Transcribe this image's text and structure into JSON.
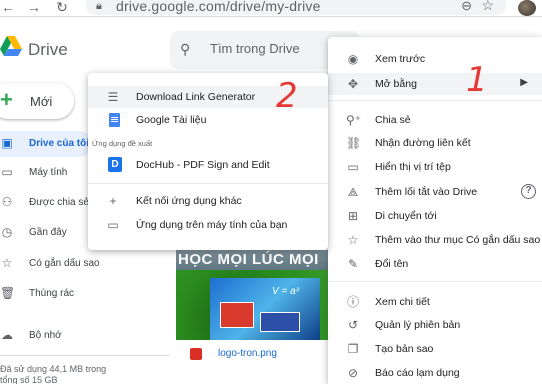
{
  "browser": {
    "url": "drive.google.com/drive/my-drive"
  },
  "header": {
    "logo_text": "Drive",
    "search_placeholder": "Tìm trong Drive"
  },
  "sidebar": {
    "new_label": "Mới",
    "items": [
      {
        "label": "Drive của tôi",
        "icon": "drive-icon",
        "active": true
      },
      {
        "label": "Máy tính",
        "icon": "computer-icon"
      },
      {
        "label": "Được chia sẻ",
        "icon": "people-icon"
      },
      {
        "label": "Gần đây",
        "icon": "clock-icon"
      },
      {
        "label": "Có gắn dấu sao",
        "icon": "star-icon"
      },
      {
        "label": "Thùng rác",
        "icon": "trash-icon"
      },
      {
        "label": "Bộ nhớ",
        "icon": "cloud-icon"
      }
    ],
    "storage_text": "Đã sử dụng 44,1 MB trong tổng số 15 GB"
  },
  "main": {
    "thumbnail_banner": "HỌC MỌI LÚC MỌI",
    "thumbnail_formula": "V = a³",
    "file_name": "logo-tron.png"
  },
  "context_menu": {
    "items": [
      {
        "label": "Xem trước",
        "icon": "eye-icon"
      },
      {
        "label": "Mở bằng",
        "icon": "move-icon",
        "submenu": true,
        "highlighted": true
      },
      {
        "label": "Chia sẻ",
        "icon": "person-add-icon"
      },
      {
        "label": "Nhận đường liên kết",
        "icon": "link-icon"
      },
      {
        "label": "Hiển thị vị trí tệp",
        "icon": "folder-icon"
      },
      {
        "label": "Thêm lối tắt vào Drive",
        "icon": "shortcut-icon",
        "help": true
      },
      {
        "label": "Di chuyển tới",
        "icon": "move-to-folder-icon"
      },
      {
        "label": "Thêm vào thư mục Có gắn dấu sao",
        "icon": "star-outline-icon"
      },
      {
        "label": "Đổi tên",
        "icon": "pencil-icon"
      },
      {
        "label": "Xem chi tiết",
        "icon": "info-icon"
      },
      {
        "label": "Quản lý phiên bản",
        "icon": "history-icon"
      },
      {
        "label": "Tạo bản sao",
        "icon": "copy-icon"
      },
      {
        "label": "Báo cáo lạm dụng",
        "icon": "report-icon"
      }
    ]
  },
  "open_with_menu": {
    "items": [
      {
        "label": "Download Link Generator",
        "icon": "list-icon",
        "highlighted": true
      },
      {
        "label": "Google Tài liệu",
        "icon": "google-docs-icon"
      }
    ],
    "section_label": "Ứng dụng đề xuất",
    "suggested": [
      {
        "label": "DocHub - PDF Sign and Edit",
        "icon": "dochub-icon"
      }
    ],
    "footer_items": [
      {
        "label": "Kết nối ứng dụng khác",
        "icon": "plus-icon"
      },
      {
        "label": "Ứng dụng trên máy tính của bạn",
        "icon": "laptop-icon"
      }
    ]
  },
  "annotations": {
    "one": "1",
    "two": "2"
  },
  "colors": {
    "accent": "#1967d2",
    "annotation": "#e53935",
    "highlight": "#f1f3f4"
  }
}
